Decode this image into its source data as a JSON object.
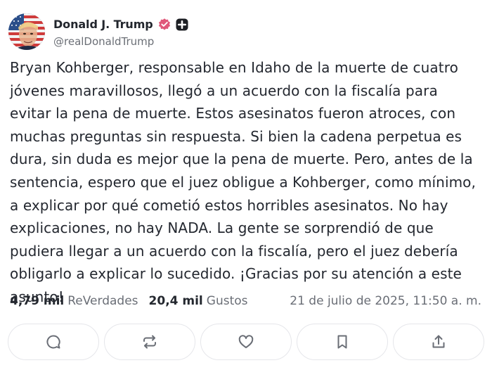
{
  "post": {
    "author": {
      "display_name": "Donald J. Trump",
      "handle": "@realDonaldTrump",
      "verified_badge_icon": "verified-badge-icon",
      "plus_badge_icon": "plus-badge-icon",
      "verified_color": "#e0587a"
    },
    "text": "Bryan Kohberger, responsable en Idaho de la muerte de cuatro jóvenes maravillosos, llegó a un acuerdo con la fiscalía para evitar la pena de muerte. Estos asesinatos fueron atroces, con muchas preguntas sin respuesta. Si bien la cadena perpetua es dura, sin duda es mejor que la pena de muerte. Pero, antes de la sentencia, espero que el juez obligue a Kohberger, como mínimo, a explicar por qué cometió estos horribles asesinatos. No hay explicaciones, no hay NADA. La gente se sorprendió de que pudiera llegar a un acuerdo con la fiscalía, pero el juez debería obligarlo a explicar lo sucedido. ¡Gracias por su atención a este asunto!",
    "stats": {
      "reposts_count": "4,79 mil",
      "reposts_label": "ReVerdades",
      "likes_count": "20,4 mil",
      "likes_label": "Gustos",
      "timestamp": "21 de julio de 2025, 11:50 a. m."
    },
    "actions": [
      {
        "icon": "comment-icon"
      },
      {
        "icon": "repost-icon"
      },
      {
        "icon": "heart-icon"
      },
      {
        "icon": "bookmark-icon"
      },
      {
        "icon": "share-icon"
      }
    ]
  }
}
